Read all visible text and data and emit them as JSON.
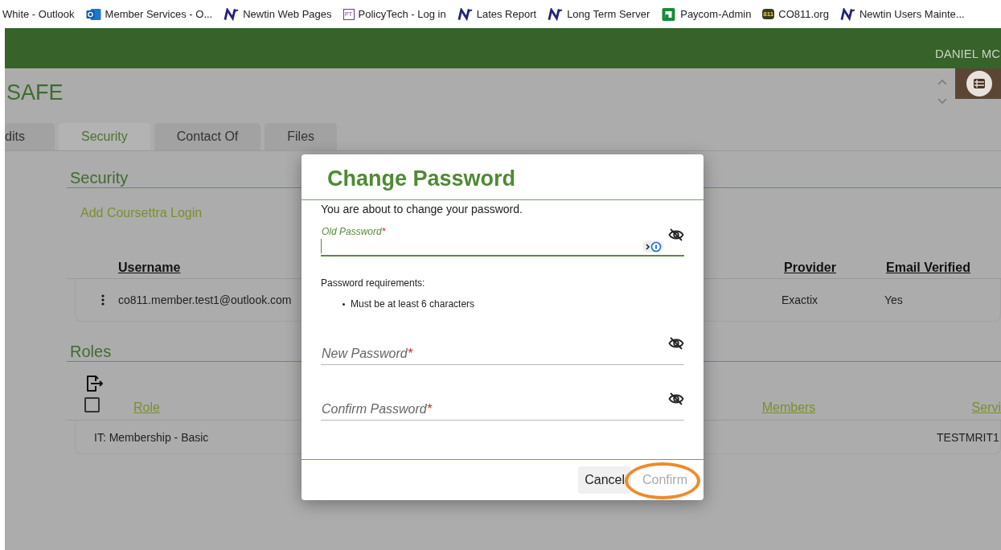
{
  "bookmarks": [
    {
      "kind": "none",
      "label": "White - Outlook"
    },
    {
      "kind": "outlook",
      "label": "Member Services - O..."
    },
    {
      "kind": "newtin",
      "label": "Newtin Web Pages"
    },
    {
      "kind": "policytech",
      "icon_text": "PT",
      "label": "PolicyTech - Log in"
    },
    {
      "kind": "newtin",
      "label": "Lates Report"
    },
    {
      "kind": "newtin",
      "label": "Long Term Server"
    },
    {
      "kind": "paycom",
      "label": "Paycom-Admin"
    },
    {
      "kind": "co811",
      "icon_text": "811",
      "label": "CO811.org"
    },
    {
      "kind": "newtin",
      "label": "Newtin Users Mainte..."
    }
  ],
  "header": {
    "user": "DANIEL MC"
  },
  "page_title": "SAFE",
  "tabs": [
    {
      "label": "dits",
      "selected": false
    },
    {
      "label": "Security",
      "selected": true
    },
    {
      "label": "Contact Of",
      "selected": false
    },
    {
      "label": "Files",
      "selected": false
    }
  ],
  "security": {
    "heading": "Security",
    "add_link": "Add Coursettra Login",
    "columns": [
      "Username",
      "Provider",
      "Email Verified"
    ],
    "rows": [
      {
        "username": "co811.member.test1@outlook.com",
        "provider": "Exactix",
        "email_verified": "Yes"
      }
    ]
  },
  "roles": {
    "heading": "Roles",
    "checked": false,
    "columns": [
      "Role",
      "Members",
      "Servi"
    ],
    "rows": [
      {
        "role": "IT: Membership - Basic",
        "service": "TESTMRIT1"
      }
    ]
  },
  "dialog": {
    "title": "Change Password",
    "intro": "You are about to change your password.",
    "fields": [
      {
        "label": "Old Password",
        "required_mark": "*",
        "focused": true
      },
      {
        "label": "New Password",
        "required_mark": "*",
        "focused": false
      },
      {
        "label": "Confirm Password",
        "required_mark": "*",
        "focused": false
      }
    ],
    "requirements_title": "Password requirements:",
    "requirements": [
      "Must be at least 6 characters"
    ],
    "buttons": [
      {
        "label": "Cancel",
        "disabled": false,
        "highlighted": false
      },
      {
        "label": "Confirm",
        "disabled": true,
        "highlighted": true
      }
    ]
  }
}
